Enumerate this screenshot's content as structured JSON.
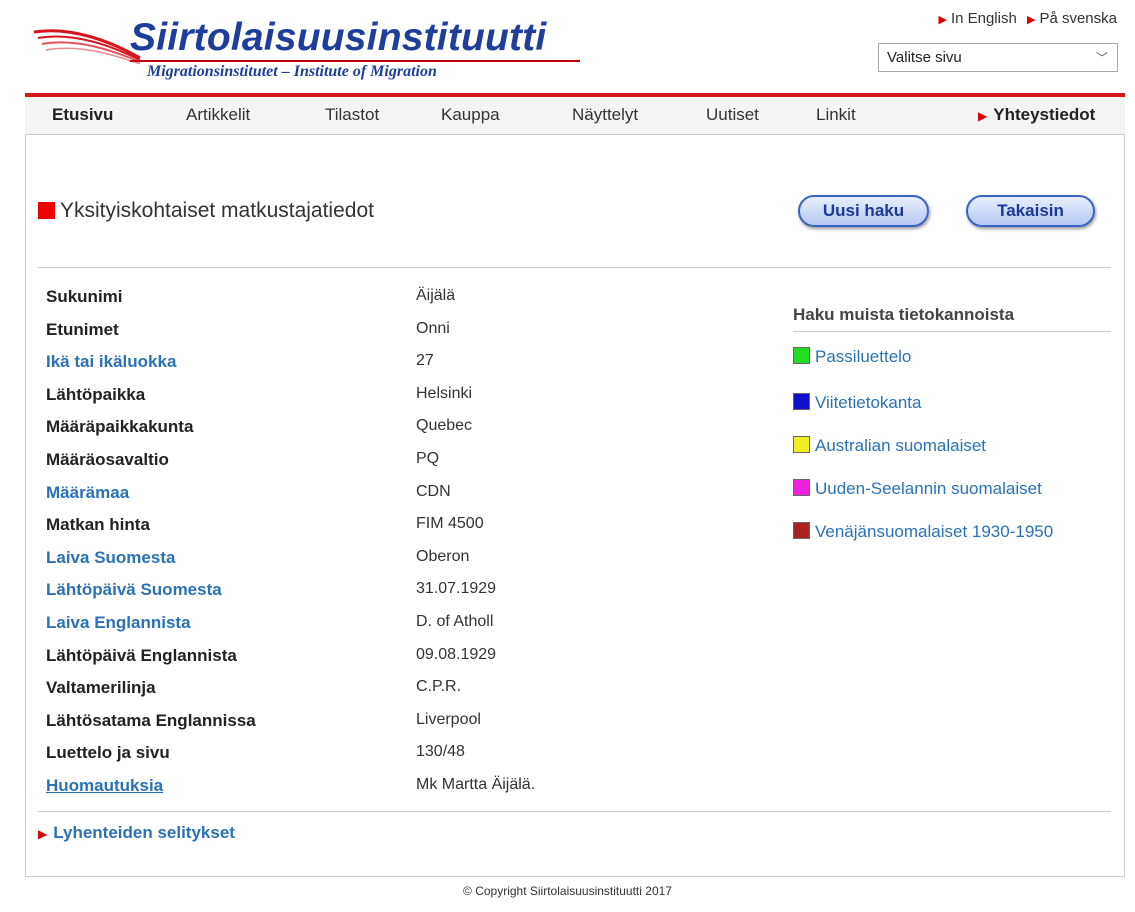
{
  "header": {
    "logo_title": "Siirtolaisuusinstituutti",
    "logo_subtitle": "Migrationsinstitutet – Institute of Migration",
    "languages": [
      "In English",
      "På svenska"
    ],
    "page_select": {
      "value": "Valitse sivu"
    }
  },
  "nav": {
    "items": [
      "Etusivu",
      "Artikkelit",
      "Tilastot",
      "Kauppa",
      "Näyttelyt",
      "Uutiset",
      "Linkit"
    ],
    "contact": "Yhteystiedot"
  },
  "main": {
    "heading": "Yksityiskohtaiset matkustajatiedot",
    "buttons": {
      "new_search": "Uusi haku",
      "back": "Takaisin"
    },
    "rows": [
      {
        "label": "Sukunimi",
        "value": "Äijälä"
      },
      {
        "label": "Etunimet",
        "value": "Onni"
      },
      {
        "label": "Ikä tai ikäluokka",
        "value": "27"
      },
      {
        "label": "Lähtöpaikka",
        "value": "Helsinki"
      },
      {
        "label": "Määräpaikkakunta",
        "value": "Quebec"
      },
      {
        "label": "Määräosavaltio",
        "value": "PQ"
      },
      {
        "label": "Määrämaa",
        "value": "CDN"
      },
      {
        "label": "Matkan hinta",
        "value": "FIM 4500"
      },
      {
        "label": "Laiva Suomesta",
        "value": "Oberon"
      },
      {
        "label": "Lähtöpäivä Suomesta",
        "value": "31.07.1929"
      },
      {
        "label": "Laiva Englannista",
        "value": "D. of Atholl"
      },
      {
        "label": "Lähtöpäivä Englannista",
        "value": "09.08.1929"
      },
      {
        "label": "Valtamerilinja",
        "value": "C.P.R."
      },
      {
        "label": "Lähtösatama Englannissa",
        "value": "Liverpool"
      },
      {
        "label": "Luettelo ja sivu",
        "value": "130/48"
      },
      {
        "label": "Huomautuksia",
        "value": "Mk Martta Äijälä."
      }
    ],
    "abbreviations_link": "Lyhenteiden selitykset"
  },
  "sidebar": {
    "title": "Haku muista tietokannoista",
    "items": [
      {
        "label": "Passiluettelo",
        "color": "#22dd22"
      },
      {
        "label": "Viitetietokanta",
        "color": "#1010cc"
      },
      {
        "label": "Australian suomalaiset",
        "color": "#eeee22"
      },
      {
        "label": "Uuden-Seelannin suomalaiset",
        "color": "#ee22dd"
      },
      {
        "label": "Venäjänsuomalaiset 1930-1950",
        "color": "#aa2222"
      }
    ]
  },
  "footer": {
    "copyright": "© Copyright Siirtolaisuusinstituutti 2017"
  },
  "colors": {
    "accent_red": "#d9141c",
    "link_blue": "#2a72b5",
    "logo_blue": "#1f3d9a"
  }
}
